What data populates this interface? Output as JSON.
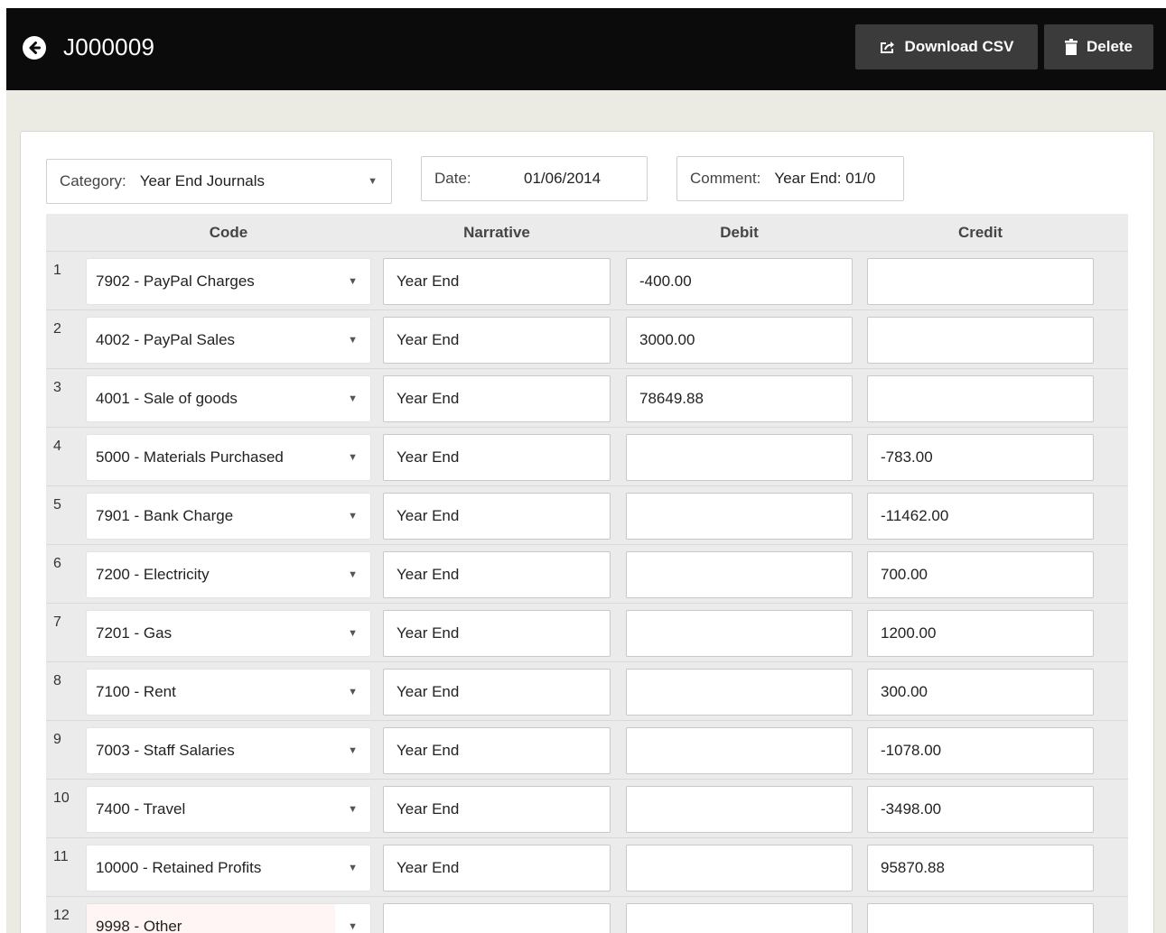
{
  "header": {
    "title": "J000009",
    "download_label": "Download CSV",
    "delete_label": "Delete"
  },
  "filters": {
    "category_label": "Category:",
    "category_value": "Year End Journals",
    "date_label": "Date:",
    "date_value": "01/06/2014",
    "comment_label": "Comment:",
    "comment_value": "Year End: 01/0"
  },
  "table": {
    "columns": [
      "Code",
      "Narrative",
      "Debit",
      "Credit"
    ],
    "rows": [
      {
        "num": "1",
        "code": "7902 - PayPal Charges",
        "narrative": "Year End",
        "debit": "-400.00",
        "credit": ""
      },
      {
        "num": "2",
        "code": "4002 - PayPal Sales",
        "narrative": "Year End",
        "debit": "3000.00",
        "credit": ""
      },
      {
        "num": "3",
        "code": "4001 - Sale of goods",
        "narrative": "Year End",
        "debit": "78649.88",
        "credit": ""
      },
      {
        "num": "4",
        "code": "5000 - Materials Purchased",
        "narrative": "Year End",
        "debit": "",
        "credit": "-783.00"
      },
      {
        "num": "5",
        "code": "7901 - Bank Charge",
        "narrative": "Year End",
        "debit": "",
        "credit": "-11462.00"
      },
      {
        "num": "6",
        "code": "7200 - Electricity",
        "narrative": "Year End",
        "debit": "",
        "credit": "700.00"
      },
      {
        "num": "7",
        "code": "7201 - Gas",
        "narrative": "Year End",
        "debit": "",
        "credit": "1200.00"
      },
      {
        "num": "8",
        "code": "7100 - Rent",
        "narrative": "Year End",
        "debit": "",
        "credit": "300.00"
      },
      {
        "num": "9",
        "code": "7003 - Staff Salaries",
        "narrative": "Year End",
        "debit": "",
        "credit": "-1078.00"
      },
      {
        "num": "10",
        "code": "7400 - Travel",
        "narrative": "Year End",
        "debit": "",
        "credit": "-3498.00"
      },
      {
        "num": "11",
        "code": "10000 - Retained Profits",
        "narrative": "Year End",
        "debit": "",
        "credit": "95870.88"
      },
      {
        "num": "12",
        "code": "9998 - Other",
        "narrative": "",
        "debit": "",
        "credit": ""
      }
    ]
  },
  "icons": {
    "back": "arrow-left-circle-icon",
    "download": "share-export-icon",
    "delete": "trash-icon",
    "dropdown": "caret-down-icon"
  },
  "colors": {
    "topbar": "#0b0b0b",
    "header_button": "#3b3b3b",
    "page_background": "#ebebe3",
    "grid_background": "#ebebeb"
  }
}
